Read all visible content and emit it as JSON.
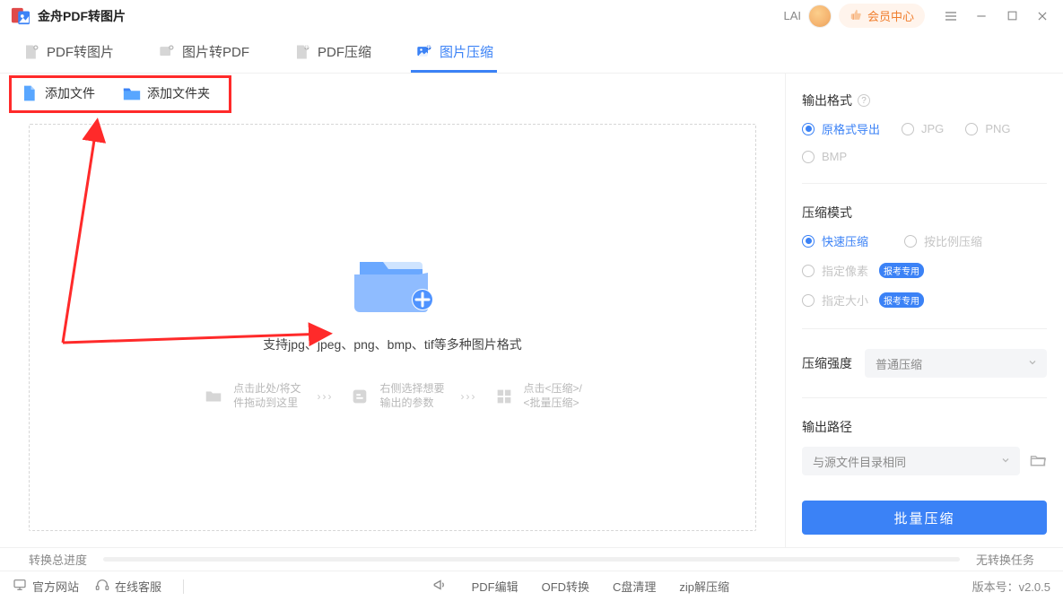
{
  "titlebar": {
    "app_name": "金舟PDF转图片",
    "user_name": "LAI",
    "vip_label": "会员中心"
  },
  "tabs": [
    {
      "label": "PDF转图片"
    },
    {
      "label": "图片转PDF"
    },
    {
      "label": "PDF压缩"
    },
    {
      "label": "图片压缩"
    }
  ],
  "actions": {
    "add_file": "添加文件",
    "add_folder": "添加文件夹"
  },
  "dropzone": {
    "supports": "支持jpg、jpeg、png、bmp、tif等多种图片格式",
    "step1_a": "点击此处/将文",
    "step1_b": "件拖动到这里",
    "step2_a": "右侧选择想要",
    "step2_b": "输出的参数",
    "step3_a": "点击<压缩>/",
    "step3_b": "<批量压缩>"
  },
  "right": {
    "output_format_title": "输出格式",
    "fmt_original": "原格式导出",
    "fmt_jpg": "JPG",
    "fmt_png": "PNG",
    "fmt_bmp": "BMP",
    "compress_mode_title": "压缩模式",
    "mode_fast": "快速压缩",
    "mode_ratio": "按比例压缩",
    "mode_pixel": "指定像素",
    "mode_size": "指定大小",
    "badge": "报考专用",
    "strength_title": "压缩强度",
    "strength_value": "普通压缩",
    "output_path_title": "输出路径",
    "output_path_value": "与源文件目录相同",
    "batch_btn": "批量压缩"
  },
  "progress": {
    "label": "转换总进度",
    "status": "无转换任务"
  },
  "footer": {
    "site": "官方网站",
    "support": "在线客服",
    "l1": "PDF编辑",
    "l2": "OFD转换",
    "l3": "C盘清理",
    "l4": "zip解压缩",
    "version": "版本号：v2.0.5"
  }
}
